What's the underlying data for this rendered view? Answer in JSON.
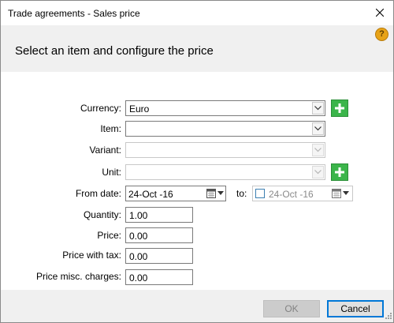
{
  "window": {
    "title": "Trade agreements - Sales price"
  },
  "header": {
    "text": "Select an item and configure the price",
    "help": "?"
  },
  "form": {
    "currency": {
      "label": "Currency:",
      "value": "Euro"
    },
    "item": {
      "label": "Item:",
      "value": ""
    },
    "variant": {
      "label": "Variant:",
      "value": ""
    },
    "unit": {
      "label": "Unit:",
      "value": ""
    },
    "from_date": {
      "label": "From date:",
      "value": "24-Oct -16"
    },
    "to_date": {
      "label": "to:",
      "value": "24-Oct -16",
      "checked": false
    },
    "quantity": {
      "label": "Quantity:",
      "value": "1.00"
    },
    "price": {
      "label": "Price:",
      "value": "0.00"
    },
    "price_with_tax": {
      "label": "Price with tax:",
      "value": "0.00"
    },
    "price_misc": {
      "label": "Price misc. charges:",
      "value": "0.00"
    }
  },
  "footer": {
    "ok_label": "OK",
    "cancel_label": "Cancel",
    "ok_enabled": false
  },
  "icons": {
    "dropdown": "chevron-down-icon",
    "add": "plus-icon",
    "calendar": "calendar-icon",
    "close": "close-icon",
    "help": "help-icon"
  },
  "colors": {
    "accent_green": "#3bb54a",
    "help_orange": "#e8a317",
    "focus_blue": "#0078d7",
    "header_band": "#f0f0f0"
  }
}
